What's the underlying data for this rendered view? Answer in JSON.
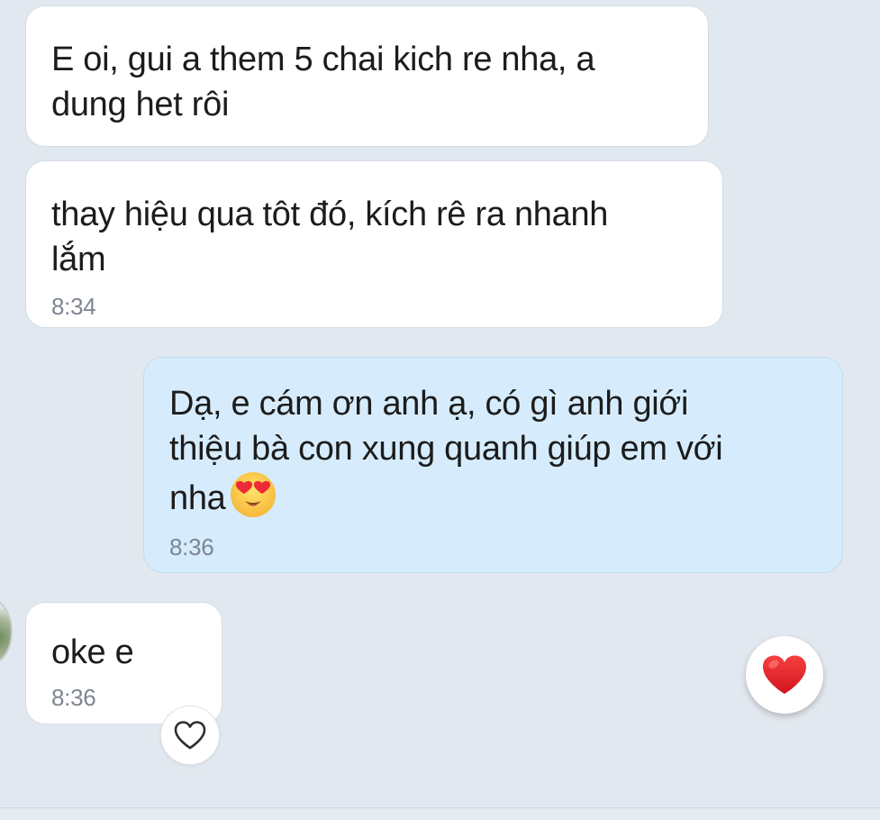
{
  "messages": [
    {
      "direction": "incoming",
      "text": "E oi, gui a them 5 chai kich re nha, a\ndung het rôi"
    },
    {
      "direction": "incoming",
      "text": "thay hiệu qua tôt đó, kích rê ra nhanh\nlắm",
      "time": "8:34"
    },
    {
      "direction": "outgoing",
      "text": "Dạ, e cám ơn anh ạ, có gì anh giới\nthiệu bà con xung quanh giúp em với\nnha",
      "emoji": "heart-eyes-emoji",
      "time": "8:36"
    },
    {
      "direction": "incoming",
      "text": "oke e",
      "time": "8:36"
    }
  ],
  "reactions": {
    "add_reaction_icon": "heart-outline-icon",
    "quick_reaction_icon": "red-heart-icon"
  },
  "colors": {
    "background": "#e2e8ef",
    "incoming_bubble": "#ffffff",
    "outgoing_bubble": "#d6ecfc",
    "timestamp": "#7d8792",
    "heart_red": "#e8202a"
  }
}
